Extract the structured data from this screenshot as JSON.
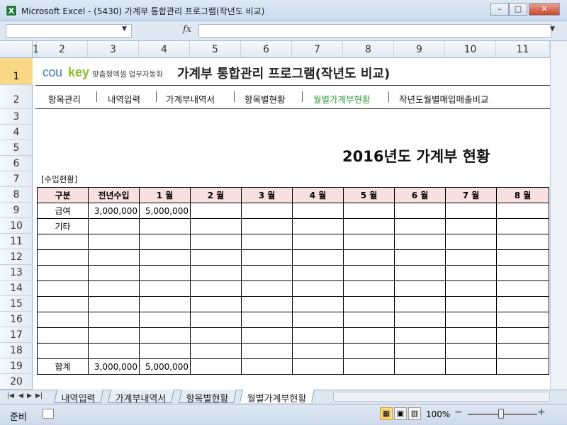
{
  "window": {
    "app_icon": "X",
    "title": "Microsoft Excel - (5430) 가계부 통합관리 프로그램(작년도 비교)",
    "minimize": "–",
    "restore": "□",
    "close": "✕"
  },
  "formula_bar": {
    "name_box": "",
    "fx": "fx",
    "content": ""
  },
  "column_headers": [
    "1",
    "2",
    "3",
    "4",
    "5",
    "6",
    "7",
    "8",
    "9",
    "10",
    "11"
  ],
  "row_headers": [
    "1",
    "2",
    "3",
    "4",
    "5",
    "6",
    "7",
    "8",
    "9",
    "10",
    "11",
    "12",
    "13",
    "14",
    "15",
    "16",
    "17",
    "18",
    "19",
    "20"
  ],
  "logo": {
    "part1": "cou",
    "part2": "key",
    "subtitle": "맞춤형엑셀 업무자동화"
  },
  "main_title": "가계부 통합관리 프로그램(작년도 비교)",
  "nav": [
    {
      "label": "항목관리",
      "active": false
    },
    {
      "label": "내역입력",
      "active": false
    },
    {
      "label": "가계부내역서",
      "active": false
    },
    {
      "label": "항목별현황",
      "active": false
    },
    {
      "label": "월별가계부현황",
      "active": true
    },
    {
      "label": "작년도월별매입매출비교",
      "active": false
    }
  ],
  "year_title": "2016년도 가계부 현황",
  "section_label": "[수입현황]",
  "table": {
    "headers": [
      "구분",
      "전년수입",
      "1 월",
      "2 월",
      "3 월",
      "4 월",
      "5 월",
      "6 월",
      "7 월",
      "8 월"
    ],
    "rows": [
      [
        "급여",
        "3,000,000",
        "5,000,000",
        "",
        "",
        "",
        "",
        "",
        "",
        ""
      ],
      [
        "기타",
        "",
        "",
        "",
        "",
        "",
        "",
        "",
        "",
        ""
      ],
      [
        "",
        "",
        "",
        "",
        "",
        "",
        "",
        "",
        "",
        ""
      ],
      [
        "",
        "",
        "",
        "",
        "",
        "",
        "",
        "",
        "",
        ""
      ],
      [
        "",
        "",
        "",
        "",
        "",
        "",
        "",
        "",
        "",
        ""
      ],
      [
        "",
        "",
        "",
        "",
        "",
        "",
        "",
        "",
        "",
        ""
      ],
      [
        "",
        "",
        "",
        "",
        "",
        "",
        "",
        "",
        "",
        ""
      ],
      [
        "",
        "",
        "",
        "",
        "",
        "",
        "",
        "",
        "",
        ""
      ],
      [
        "",
        "",
        "",
        "",
        "",
        "",
        "",
        "",
        "",
        ""
      ],
      [
        "",
        "",
        "",
        "",
        "",
        "",
        "",
        "",
        "",
        ""
      ],
      [
        "합계",
        "3,000,000",
        "5,000,000",
        "",
        "",
        "",
        "",
        "",
        "",
        ""
      ]
    ]
  },
  "sheet_tabs": [
    {
      "label": "내역입력",
      "active": false
    },
    {
      "label": "가계부내역서",
      "active": false
    },
    {
      "label": "항목별현황",
      "active": false
    },
    {
      "label": "월별가계부현황",
      "active": true
    }
  ],
  "status": {
    "ready": "준비",
    "zoom": "100%",
    "zoom_out": "−",
    "zoom_in": "+"
  }
}
